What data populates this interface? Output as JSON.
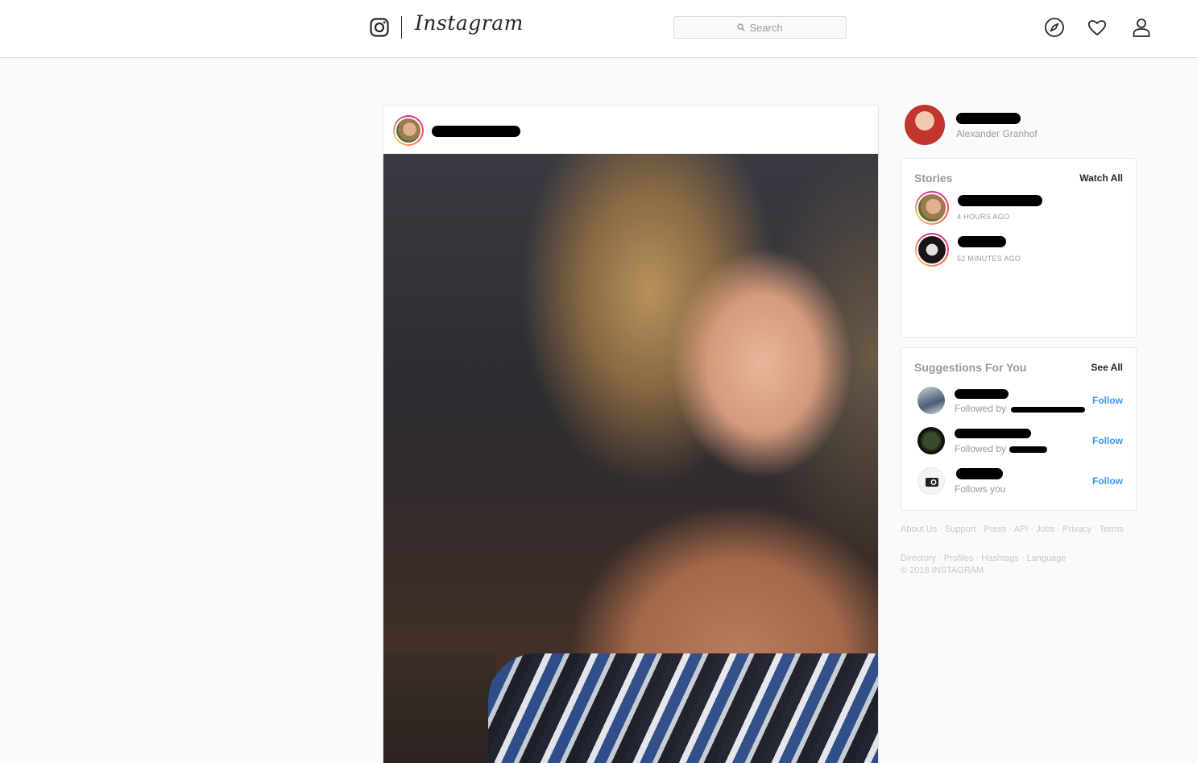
{
  "nav": {
    "wordmark": "Instagram",
    "search_placeholder": "Search",
    "icons": [
      "instagram-glyph-icon",
      "compass-icon",
      "heart-icon",
      "profile-icon"
    ]
  },
  "viewer": {
    "full_name": "Alexander Granhof"
  },
  "stories": {
    "title": "Stories",
    "watch_all": "Watch All",
    "items": [
      {
        "time": "4 HOURS AGO"
      },
      {
        "time": "52 MINUTES AGO"
      }
    ]
  },
  "suggestions": {
    "title": "Suggestions For You",
    "see_all": "See All",
    "items": [
      {
        "subtitle": "Followed by",
        "action": "Follow"
      },
      {
        "subtitle": "Followed by",
        "action": "Follow"
      },
      {
        "subtitle": "Follows you",
        "action": "Follow"
      }
    ]
  },
  "footer": {
    "links": [
      "About Us",
      "Support",
      "Press",
      "API",
      "Jobs",
      "Privacy",
      "Terms",
      "Directory",
      "Profiles",
      "Hashtags",
      "Language"
    ],
    "copyright": "© 2018 INSTAGRAM"
  },
  "colors": {
    "link_blue": "#3897f0",
    "muted_text": "#999999",
    "border": "#dbdbdb"
  }
}
